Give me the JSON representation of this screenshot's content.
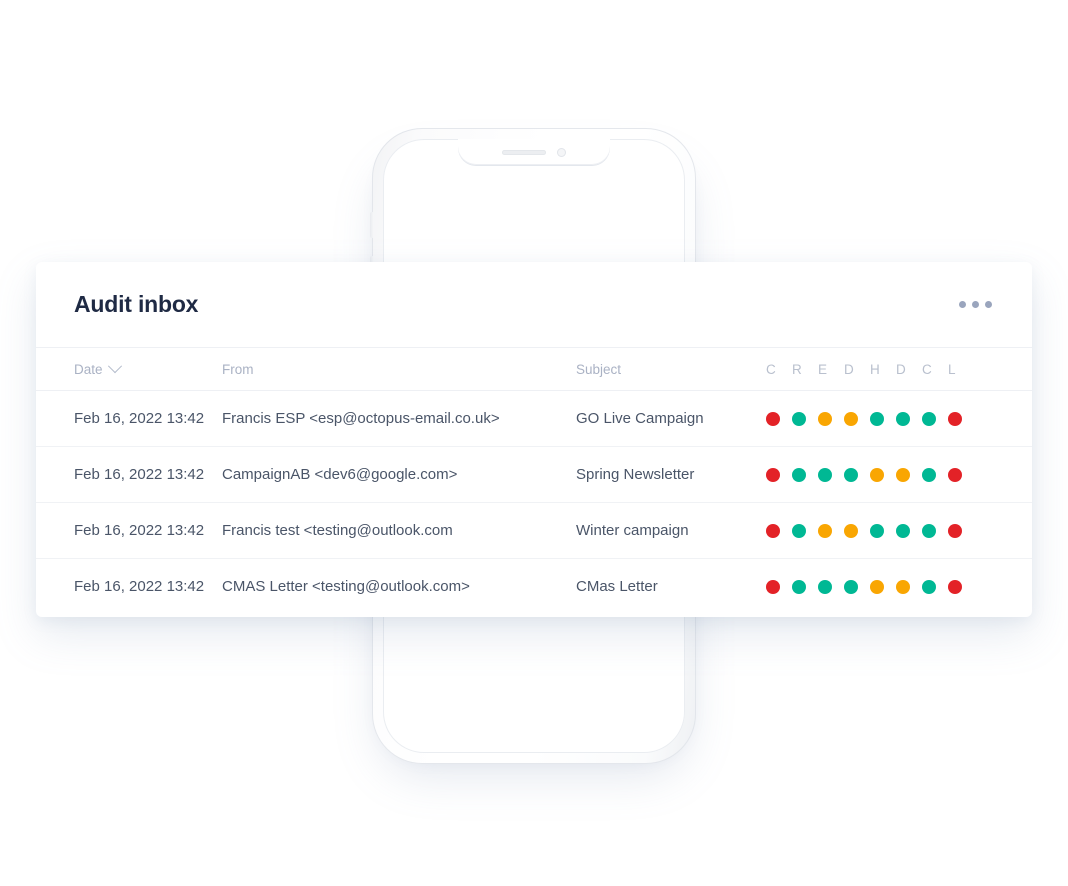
{
  "card": {
    "title": "Audit inbox",
    "menu_icon": "kebab-menu-icon"
  },
  "table": {
    "columns": {
      "date": "Date",
      "from": "From",
      "subject": "Subject"
    },
    "sort_icon": "chevron-down-icon",
    "status_columns": [
      "C",
      "R",
      "E",
      "D",
      "H",
      "D",
      "C",
      "L"
    ],
    "status_colors": {
      "red": "#e32227",
      "teal": "#00b894",
      "orange": "#f9a602"
    },
    "rows": [
      {
        "date": "Feb 16, 2022 13:42",
        "from": "Francis ESP <esp@octopus-email.co.uk>",
        "subject": "GO Live Campaign",
        "statuses": [
          "red",
          "teal",
          "orange",
          "orange",
          "teal",
          "teal",
          "teal",
          "red"
        ]
      },
      {
        "date": "Feb 16, 2022 13:42",
        "from": "CampaignAB <dev6@google.com>",
        "subject": "Spring Newsletter",
        "statuses": [
          "red",
          "teal",
          "teal",
          "teal",
          "orange",
          "orange",
          "teal",
          "red"
        ]
      },
      {
        "date": "Feb 16, 2022 13:42",
        "from": "Francis test <testing@outlook.com",
        "subject": "Winter campaign",
        "statuses": [
          "red",
          "teal",
          "orange",
          "orange",
          "teal",
          "teal",
          "teal",
          "red"
        ]
      },
      {
        "date": "Feb 16, 2022 13:42",
        "from": "CMAS Letter <testing@outlook.com>",
        "subject": "CMas Letter",
        "statuses": [
          "red",
          "teal",
          "teal",
          "teal",
          "orange",
          "orange",
          "teal",
          "red"
        ]
      }
    ]
  },
  "phone": {
    "notch_speaker": "speaker-grille",
    "notch_camera": "front-camera-icon"
  }
}
